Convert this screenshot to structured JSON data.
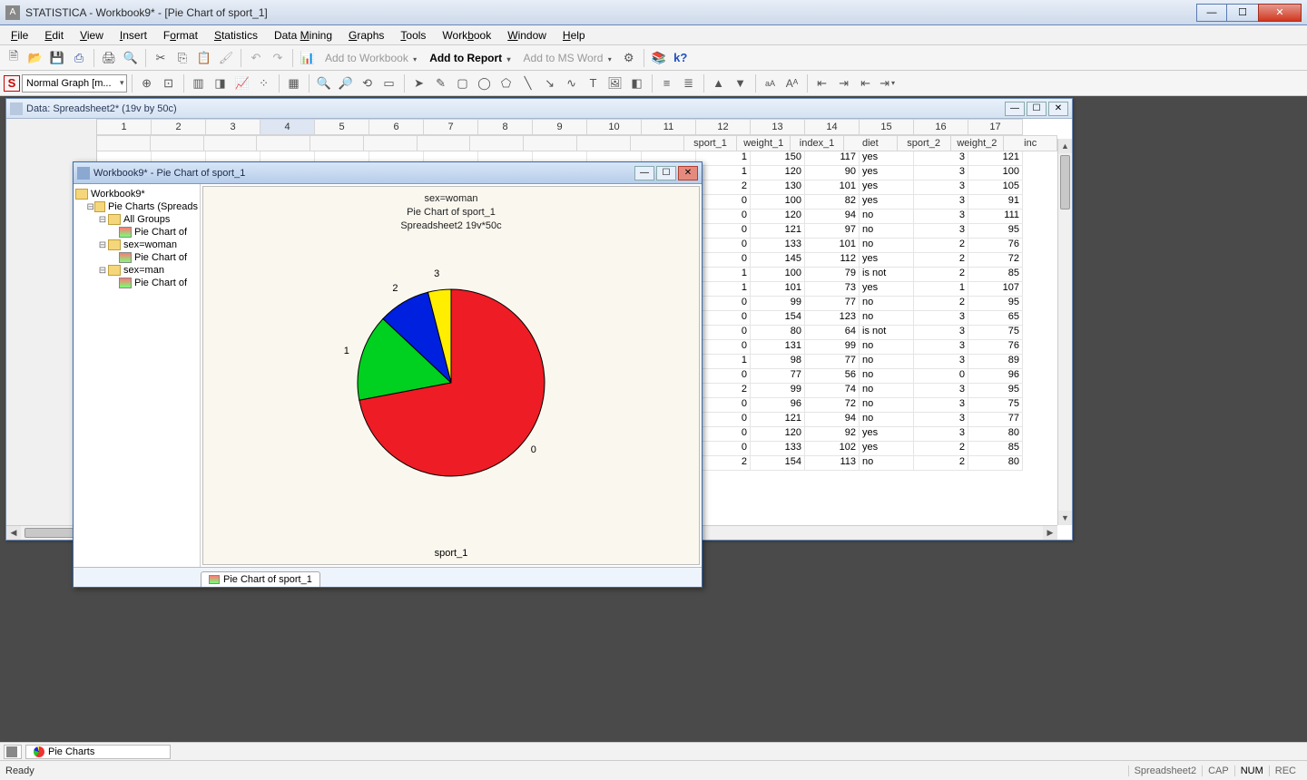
{
  "app": {
    "title": "STATISTICA - Workbook9* - [Pie Chart of sport_1]"
  },
  "menu": [
    "File",
    "Edit",
    "View",
    "Insert",
    "Format",
    "Statistics",
    "Data Mining",
    "Graphs",
    "Tools",
    "Workbook",
    "Window",
    "Help"
  ],
  "toolbar1": {
    "add_workbook": "Add to Workbook",
    "add_report": "Add to Report",
    "add_word": "Add to MS Word"
  },
  "toolbar2": {
    "combo_label": "Normal Graph [m..."
  },
  "sheet_window": {
    "title": "Data: Spreadsheet2* (19v by 50c)",
    "col_nums": [
      "1",
      "2",
      "3",
      "4",
      "5",
      "6",
      "7",
      "8",
      "9",
      "10",
      "11",
      "12",
      "13",
      "14",
      "15",
      "16",
      "17"
    ],
    "col_names": [
      "",
      "",
      "",
      "",
      "",
      "",
      "",
      "",
      "",
      "",
      "",
      "sport_1",
      "weight_1",
      "index_1",
      "diet",
      "sport_2",
      "weight_2",
      "inc"
    ],
    "rows": [
      {
        "sport_1": "1",
        "weight_1": "150",
        "index_1": "117",
        "diet": "yes",
        "sport_2": "3",
        "weight_2": "121"
      },
      {
        "sport_1": "1",
        "weight_1": "120",
        "index_1": "90",
        "diet": "yes",
        "sport_2": "3",
        "weight_2": "100"
      },
      {
        "sport_1": "2",
        "weight_1": "130",
        "index_1": "101",
        "diet": "yes",
        "sport_2": "3",
        "weight_2": "105"
      },
      {
        "sport_1": "0",
        "weight_1": "100",
        "index_1": "82",
        "diet": "yes",
        "sport_2": "3",
        "weight_2": "91"
      },
      {
        "sport_1": "0",
        "weight_1": "120",
        "index_1": "94",
        "diet": "no",
        "sport_2": "3",
        "weight_2": "111"
      },
      {
        "sport_1": "0",
        "weight_1": "121",
        "index_1": "97",
        "diet": "no",
        "sport_2": "3",
        "weight_2": "95"
      },
      {
        "sport_1": "0",
        "weight_1": "133",
        "index_1": "101",
        "diet": "no",
        "sport_2": "2",
        "weight_2": "76"
      },
      {
        "sport_1": "0",
        "weight_1": "145",
        "index_1": "112",
        "diet": "yes",
        "sport_2": "2",
        "weight_2": "72"
      },
      {
        "sport_1": "1",
        "weight_1": "100",
        "index_1": "79",
        "diet": "is not",
        "sport_2": "2",
        "weight_2": "85"
      },
      {
        "sport_1": "1",
        "weight_1": "101",
        "index_1": "73",
        "diet": "yes",
        "sport_2": "1",
        "weight_2": "107"
      },
      {
        "sport_1": "0",
        "weight_1": "99",
        "index_1": "77",
        "diet": "no",
        "sport_2": "2",
        "weight_2": "95"
      },
      {
        "sport_1": "0",
        "weight_1": "154",
        "index_1": "123",
        "diet": "no",
        "sport_2": "3",
        "weight_2": "65"
      },
      {
        "sport_1": "0",
        "weight_1": "80",
        "index_1": "64",
        "diet": "is not",
        "sport_2": "3",
        "weight_2": "75"
      },
      {
        "sport_1": "0",
        "weight_1": "131",
        "index_1": "99",
        "diet": "no",
        "sport_2": "3",
        "weight_2": "76"
      },
      {
        "sport_1": "1",
        "weight_1": "98",
        "index_1": "77",
        "diet": "no",
        "sport_2": "3",
        "weight_2": "89"
      },
      {
        "sport_1": "0",
        "weight_1": "77",
        "index_1": "56",
        "diet": "no",
        "sport_2": "0",
        "weight_2": "96"
      },
      {
        "sport_1": "2",
        "weight_1": "99",
        "index_1": "74",
        "diet": "no",
        "sport_2": "3",
        "weight_2": "95"
      },
      {
        "sport_1": "0",
        "weight_1": "96",
        "index_1": "72",
        "diet": "no",
        "sport_2": "3",
        "weight_2": "75"
      },
      {
        "sport_1": "0",
        "weight_1": "121",
        "index_1": "94",
        "diet": "no",
        "sport_2": "3",
        "weight_2": "77"
      },
      {
        "sport_1": "0",
        "weight_1": "120",
        "index_1": "92",
        "diet": "yes",
        "sport_2": "3",
        "weight_2": "80"
      },
      {
        "sport_1": "0",
        "weight_1": "133",
        "index_1": "102",
        "diet": "yes",
        "sport_2": "2",
        "weight_2": "85"
      },
      {
        "sport_1": "2",
        "weight_1": "154",
        "index_1": "113",
        "diet": "no",
        "sport_2": "2",
        "weight_2": "80"
      }
    ]
  },
  "workbook_window": {
    "title": "Workbook9* - Pie Chart of sport_1",
    "tree": {
      "root": "Workbook9*",
      "group": "Pie Charts (Spreads",
      "all_groups": "All Groups",
      "chart_label": "Pie Chart of",
      "sex_woman": "sex=woman",
      "sex_man": "sex=man"
    },
    "chart_titles": {
      "line1": "sex=woman",
      "line2": "Pie Chart of sport_1",
      "line3": "Spreadsheet2 19v*50c"
    },
    "xlabel": "sport_1",
    "tab": "Pie Chart of sport_1"
  },
  "chart_data": {
    "type": "pie",
    "title": "Pie Chart of sport_1",
    "subtitle": "sex=woman",
    "source": "Spreadsheet2 19v*50c",
    "xlabel": "sport_1",
    "slices": [
      {
        "label": "0",
        "fraction": 0.72,
        "color": "#ee1c24"
      },
      {
        "label": "1",
        "fraction": 0.15,
        "color": "#00d020"
      },
      {
        "label": "2",
        "fraction": 0.09,
        "color": "#0020e0"
      },
      {
        "label": "3",
        "fraction": 0.04,
        "color": "#ffee00"
      }
    ]
  },
  "taskbar": {
    "pie_charts": "Pie Charts"
  },
  "statusbar": {
    "ready": "Ready",
    "sheet": "Spreadsheet2",
    "cap": "CAP",
    "num": "NUM",
    "rec": "REC"
  }
}
